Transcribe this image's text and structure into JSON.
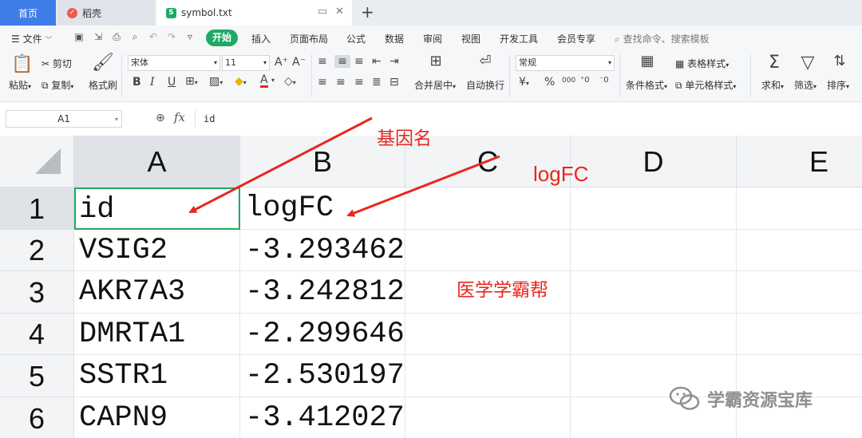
{
  "tabs": {
    "home": "首页",
    "daoke": "稻壳",
    "file": "symbol.txt"
  },
  "menu": {
    "file": "文件",
    "start": "开始",
    "items": [
      "插入",
      "页面布局",
      "公式",
      "数据",
      "审阅",
      "视图",
      "开发工具",
      "会员专享"
    ],
    "search": "查找命令、搜索模板"
  },
  "ribbon": {
    "paste": "粘贴",
    "cut": "剪切",
    "copy": "复制",
    "format_painter": "格式刷",
    "font_name": "宋体",
    "font_size": "11",
    "bold": "B",
    "italic": "I",
    "underline": "U",
    "merge_center": "合并居中",
    "wrap_text": "自动换行",
    "number_format": "常规",
    "currency": "¥",
    "percent": "%",
    "thousands": "000",
    "conditional_format": "条件格式",
    "table_style": "表格样式",
    "cell_style": "单元格样式",
    "sum": "求和",
    "filter": "筛选",
    "sort": "排序"
  },
  "formula_bar": {
    "name_box": "A1",
    "fx": "fx",
    "content": "id"
  },
  "sheet": {
    "columns": [
      "A",
      "B",
      "C",
      "D",
      "E"
    ],
    "rows": [
      "1",
      "2",
      "3",
      "4",
      "5",
      "6"
    ],
    "data": [
      [
        "id",
        "logFC"
      ],
      [
        "VSIG2",
        "-3.293462"
      ],
      [
        "AKR7A3",
        "-3.242812"
      ],
      [
        "DMRTA1",
        "-2.299646"
      ],
      [
        "SSTR1",
        "-2.530197"
      ],
      [
        "CAPN9",
        "-3.412027"
      ]
    ]
  },
  "annotations": {
    "gene_name": "基因名",
    "logfc": "logFC",
    "brand": "医学学霸帮"
  },
  "watermark": "学霸资源宝库",
  "colors": {
    "accent_green": "#1eaa62",
    "tab_blue": "#3f7ee8",
    "annotation_red": "#e8271f"
  }
}
